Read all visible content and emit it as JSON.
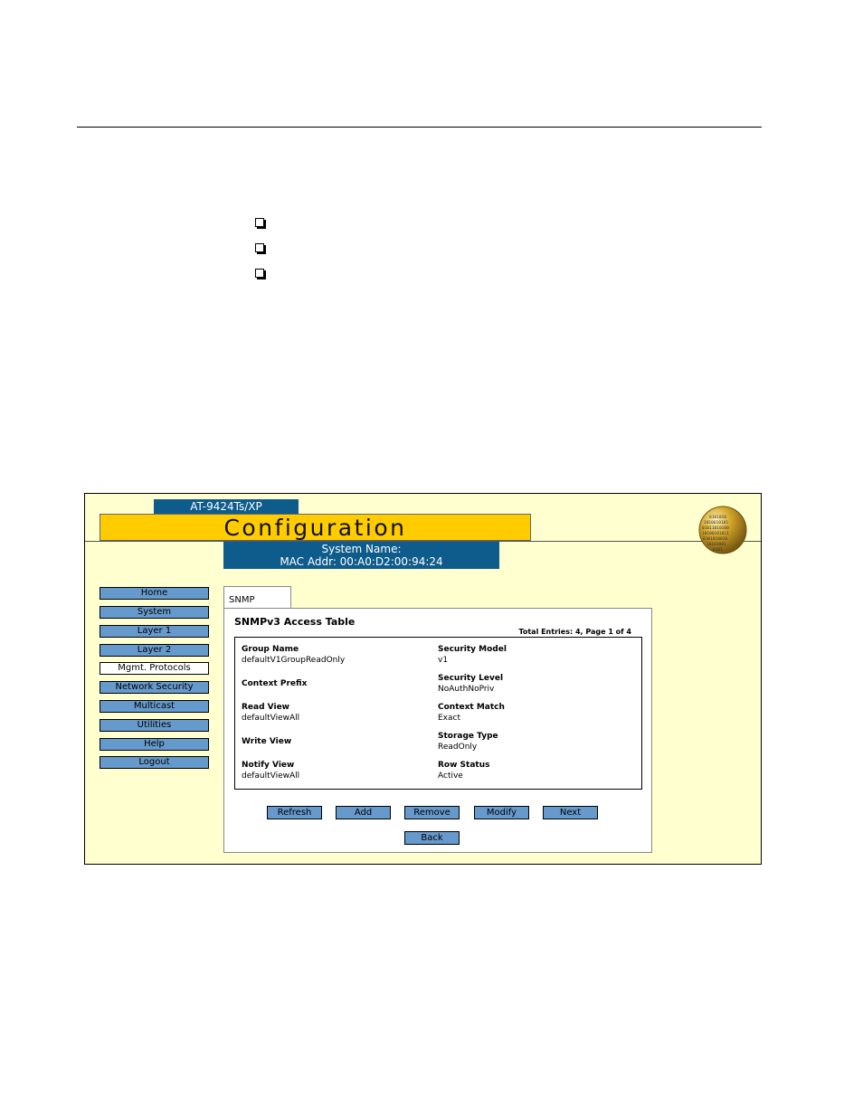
{
  "header": {
    "model": "AT-9424Ts/XP",
    "title": "Configuration",
    "system_name": "System Name:",
    "mac_addr": "MAC Addr: 00:A0:D2:00:94:24"
  },
  "nav": {
    "items": [
      {
        "label": "Home"
      },
      {
        "label": "System"
      },
      {
        "label": "Layer 1"
      },
      {
        "label": "Layer 2"
      },
      {
        "label": "Mgmt. Protocols"
      },
      {
        "label": "Network Security"
      },
      {
        "label": "Multicast"
      },
      {
        "label": "Utilities"
      },
      {
        "label": "Help"
      },
      {
        "label": "Logout"
      }
    ],
    "active": "Mgmt. Protocols"
  },
  "tab": {
    "label": "SNMP"
  },
  "panel": {
    "title": "SNMPv3 Access Table",
    "entries": "Total Entries: 4, Page 1 of 4"
  },
  "fields": {
    "group_name": {
      "label": "Group Name",
      "value": "defaultV1GroupReadOnly"
    },
    "context_prefix": {
      "label": "Context Prefix",
      "value": ""
    },
    "read_view": {
      "label": "Read View",
      "value": "defaultViewAll"
    },
    "write_view": {
      "label": "Write View",
      "value": ""
    },
    "notify_view": {
      "label": "Notify View",
      "value": "defaultViewAll"
    },
    "security_model": {
      "label": "Security Model",
      "value": "v1"
    },
    "security_level": {
      "label": "Security Level",
      "value": "NoAuthNoPriv"
    },
    "context_match": {
      "label": "Context Match",
      "value": "Exact"
    },
    "storage_type": {
      "label": "Storage Type",
      "value": "ReadOnly"
    },
    "row_status": {
      "label": "Row Status",
      "value": "Active"
    }
  },
  "buttons": {
    "refresh": "Refresh",
    "add": "Add",
    "remove": "Remove",
    "modify": "Modify",
    "next": "Next",
    "back": "Back"
  },
  "colors": {
    "frame_bg": "#ffffd0",
    "title_bar": "#ffcc00",
    "header_blue": "#0e5c8c",
    "button_blue": "#6699cc"
  }
}
